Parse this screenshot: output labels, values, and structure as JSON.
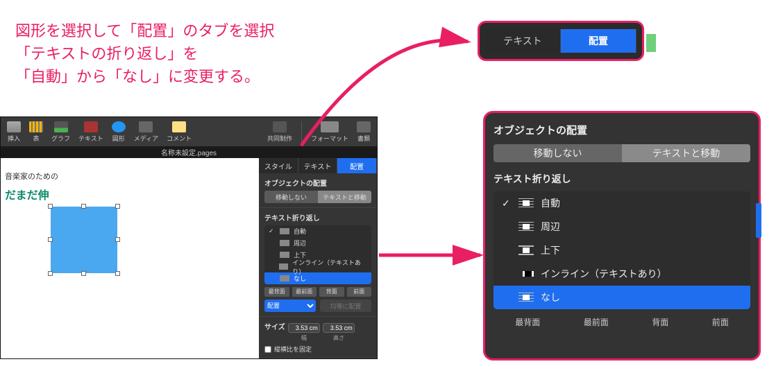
{
  "instruction": {
    "line1": "図形を選択して「配置」のタブを選択",
    "line2": "「テキストの折り返し」を",
    "line3": "「自動」から「なし」に変更する。"
  },
  "toolbar": {
    "items": [
      {
        "name": "insert",
        "label": "挿入"
      },
      {
        "name": "table",
        "label": "表"
      },
      {
        "name": "chart",
        "label": "グラフ"
      },
      {
        "name": "text",
        "label": "テキスト"
      },
      {
        "name": "shape",
        "label": "図形"
      },
      {
        "name": "media",
        "label": "メディア"
      },
      {
        "name": "comment",
        "label": "コメント"
      }
    ],
    "share": "共同制作",
    "format": "フォーマット",
    "doc": "書類"
  },
  "doc_tab": "名称未設定.pages",
  "canvas": {
    "heading": "音楽家のための",
    "sub": "だまだ伸"
  },
  "inspector": {
    "tabs": {
      "style": "スタイル",
      "text": "テキスト",
      "arrange": "配置"
    },
    "placement_head": "オブジェクトの配置",
    "placement": {
      "stay": "移動しない",
      "move": "テキストと移動"
    },
    "wrap_head": "テキスト折り返し",
    "wrap_options": [
      {
        "key": "auto",
        "label": "自動",
        "checked": true
      },
      {
        "key": "around",
        "label": "周辺"
      },
      {
        "key": "topbot",
        "label": "上下"
      },
      {
        "key": "inline",
        "label": "インライン（テキストあり）"
      },
      {
        "key": "none",
        "label": "なし",
        "selected": true
      }
    ],
    "order": {
      "backmost": "最背面",
      "frontmost": "最前面",
      "back": "背面",
      "front": "前面"
    },
    "align_select": "配置",
    "align_disabled": "均等に配置",
    "size_head": "サイズ",
    "width": "3.53 cm",
    "height": "3.53 cm",
    "w_label": "幅",
    "h_label": "高さ",
    "constrain": "縦横比を固定"
  },
  "zoom_tabs": {
    "text": "テキスト",
    "arrange": "配置"
  },
  "zoom_wrap": {
    "head": "オブジェクトの配置",
    "seg": {
      "stay": "移動しない",
      "move": "テキストと移動"
    },
    "sub": "テキスト折り返し",
    "options": [
      {
        "key": "auto",
        "label": "自動",
        "checked": true
      },
      {
        "key": "around",
        "label": "周辺"
      },
      {
        "key": "topbot",
        "label": "上下"
      },
      {
        "key": "inline",
        "label": "インライン（テキストあり）"
      },
      {
        "key": "none",
        "label": "なし",
        "selected": true
      }
    ],
    "order": {
      "backmost": "最背面",
      "frontmost": "最前面",
      "back": "背面",
      "front": "前面"
    }
  }
}
